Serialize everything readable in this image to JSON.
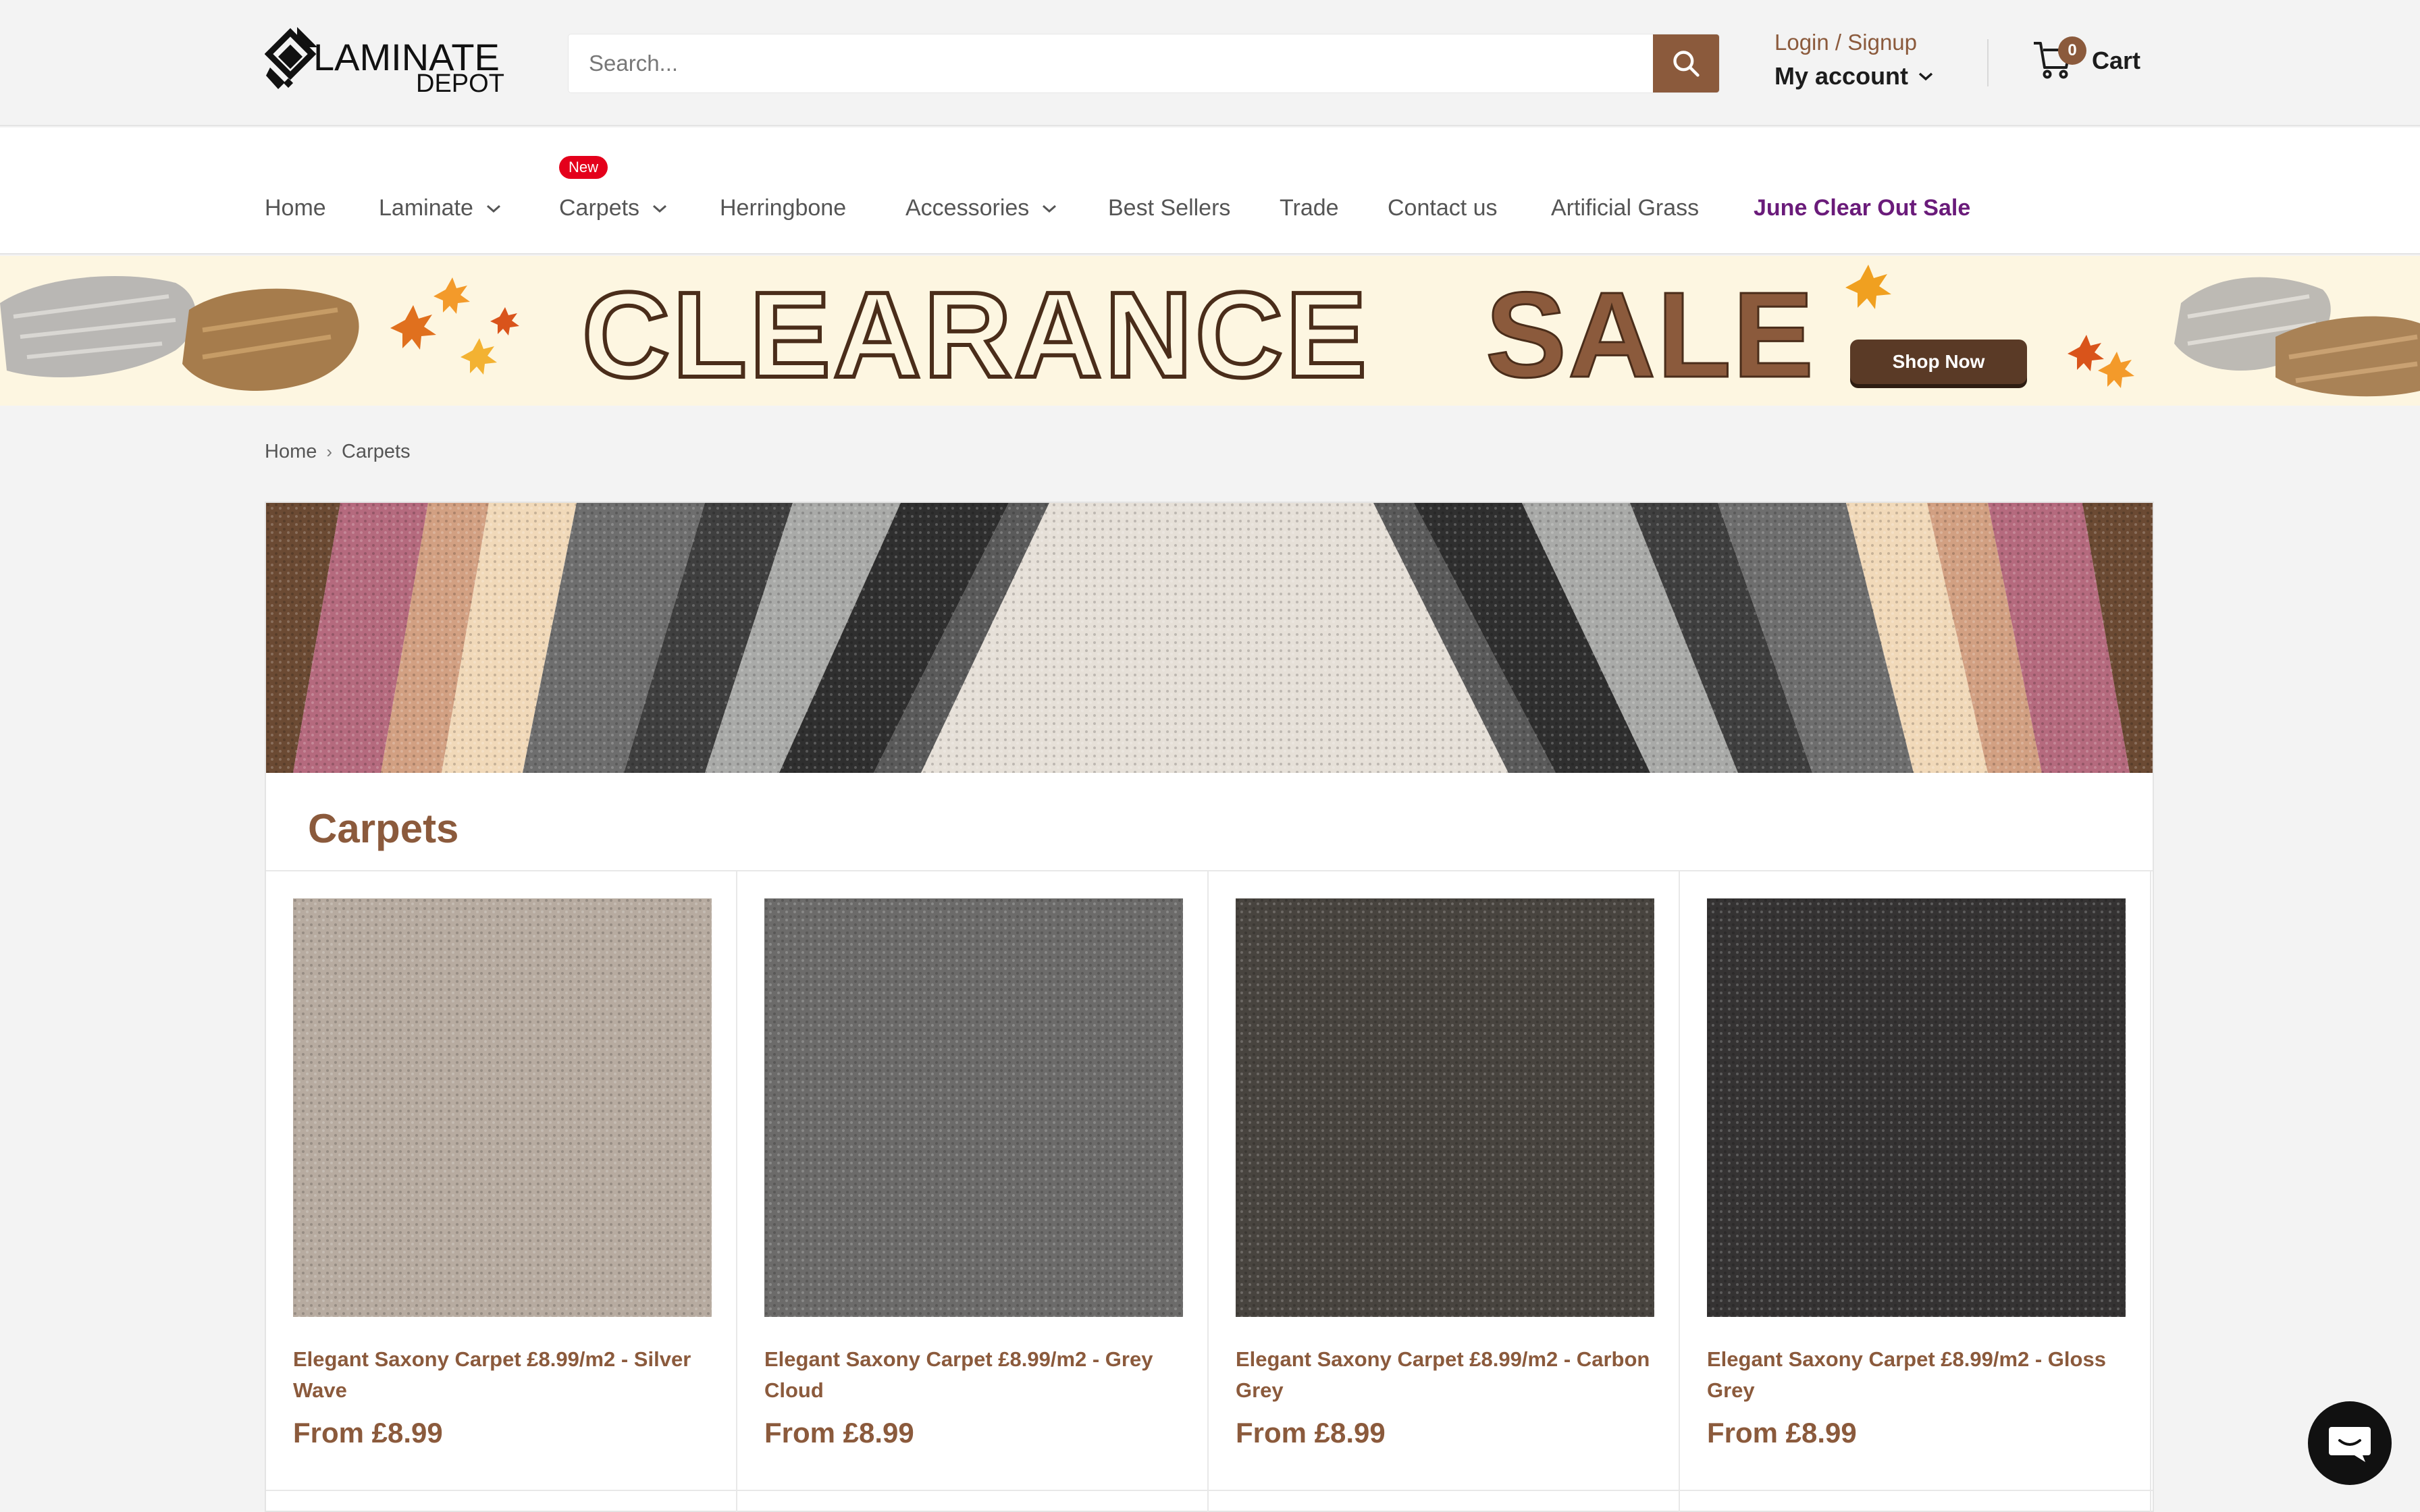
{
  "brand": {
    "logo_line1": "LAMINATE",
    "logo_line2": "DEPOT"
  },
  "search": {
    "placeholder": "Search..."
  },
  "account": {
    "login_label": "Login / Signup",
    "my_account_label": "My account"
  },
  "cart": {
    "count": "0",
    "label": "Cart"
  },
  "nav": {
    "new_badge": "New",
    "items": [
      {
        "label": "Home"
      },
      {
        "label": "Laminate"
      },
      {
        "label": "Carpets"
      },
      {
        "label": "Herringbone"
      },
      {
        "label": "Accessories"
      },
      {
        "label": "Best Sellers"
      },
      {
        "label": "Trade"
      },
      {
        "label": "Contact us"
      },
      {
        "label": "Artificial Grass"
      },
      {
        "label": "June Clear Out Sale"
      }
    ]
  },
  "promo": {
    "word1": "CLEARANCE",
    "word2": "SALE",
    "cta": "Shop Now"
  },
  "breadcrumb": {
    "home": "Home",
    "separator": "›",
    "current": "Carpets"
  },
  "collection": {
    "title": "Carpets",
    "products": [
      {
        "name": "Elegant Saxony Carpet £8.99/m2 - Silver Wave",
        "price": "From £8.99",
        "swatch": "#b7aba0"
      },
      {
        "name": "Elegant Saxony Carpet £8.99/m2 - Grey Cloud",
        "price": "From £8.99",
        "swatch": "#6c6b6a"
      },
      {
        "name": "Elegant Saxony Carpet £8.99/m2 - Carbon Grey",
        "price": "From £8.99",
        "swatch": "#48443f"
      },
      {
        "name": "Elegant Saxony Carpet £8.99/m2 - Gloss Grey",
        "price": "From £8.99",
        "swatch": "#353333"
      }
    ]
  },
  "colors": {
    "accent": "#8b5a3c",
    "sale": "#6a1b7a",
    "badge": "#e4001b"
  },
  "icons": [
    "search-icon",
    "chevron-down-icon",
    "cart-icon",
    "chat-icon"
  ]
}
